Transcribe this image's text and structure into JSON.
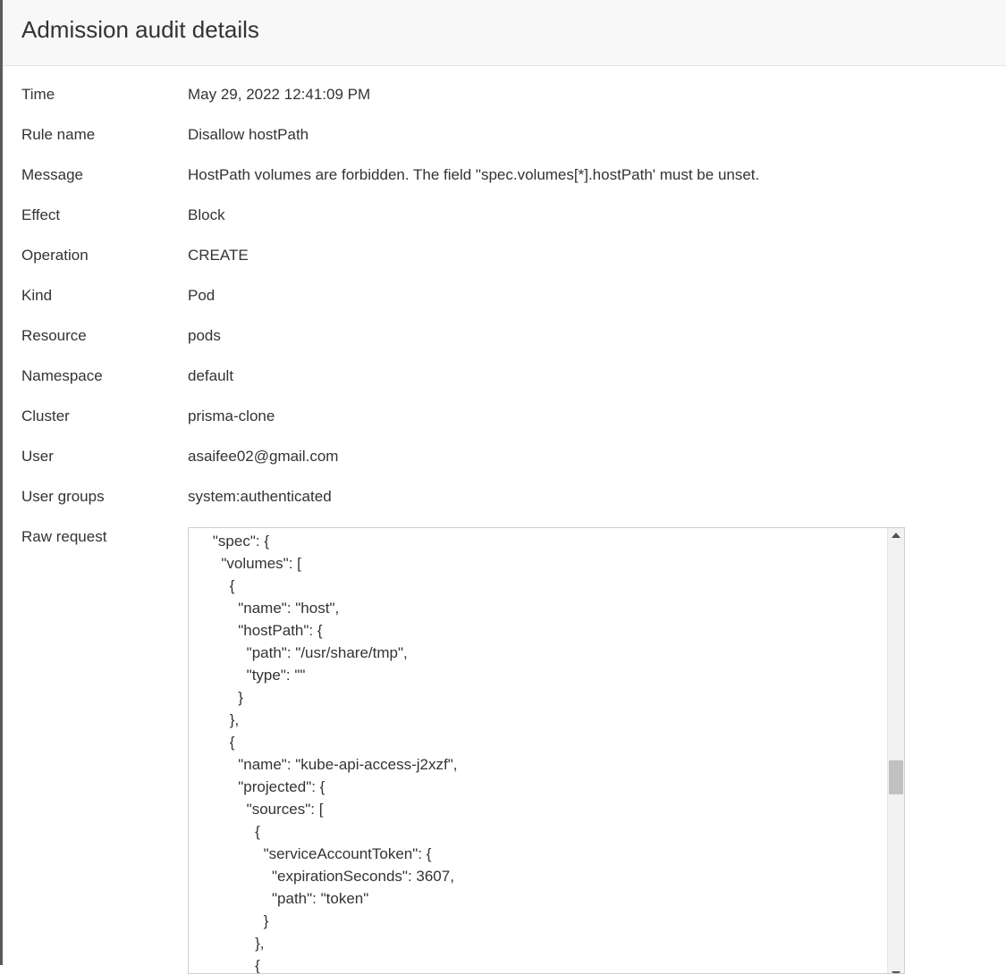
{
  "modal": {
    "title": "Admission audit details"
  },
  "details": [
    {
      "label": "Time",
      "value": "May 29, 2022 12:41:09 PM"
    },
    {
      "label": "Rule name",
      "value": "Disallow hostPath"
    },
    {
      "label": "Message",
      "value": "HostPath volumes are forbidden. The field \"spec.volumes[*].hostPath' must be unset."
    },
    {
      "label": "Effect",
      "value": "Block"
    },
    {
      "label": "Operation",
      "value": "CREATE"
    },
    {
      "label": "Kind",
      "value": "Pod"
    },
    {
      "label": "Resource",
      "value": "pods"
    },
    {
      "label": "Namespace",
      "value": "default"
    },
    {
      "label": "Cluster",
      "value": "prisma-clone"
    },
    {
      "label": "User",
      "value": "asaifee02@gmail.com"
    },
    {
      "label": "User groups",
      "value": "system:authenticated"
    }
  ],
  "raw_request": {
    "label": "Raw request",
    "content": "    \"spec\": {\n      \"volumes\": [\n        {\n          \"name\": \"host\",\n          \"hostPath\": {\n            \"path\": \"/usr/share/tmp\",\n            \"type\": \"\"\n          }\n        },\n        {\n          \"name\": \"kube-api-access-j2xzf\",\n          \"projected\": {\n            \"sources\": [\n              {\n                \"serviceAccountToken\": {\n                  \"expirationSeconds\": 3607,\n                  \"path\": \"token\"\n                }\n              },\n              {"
  }
}
